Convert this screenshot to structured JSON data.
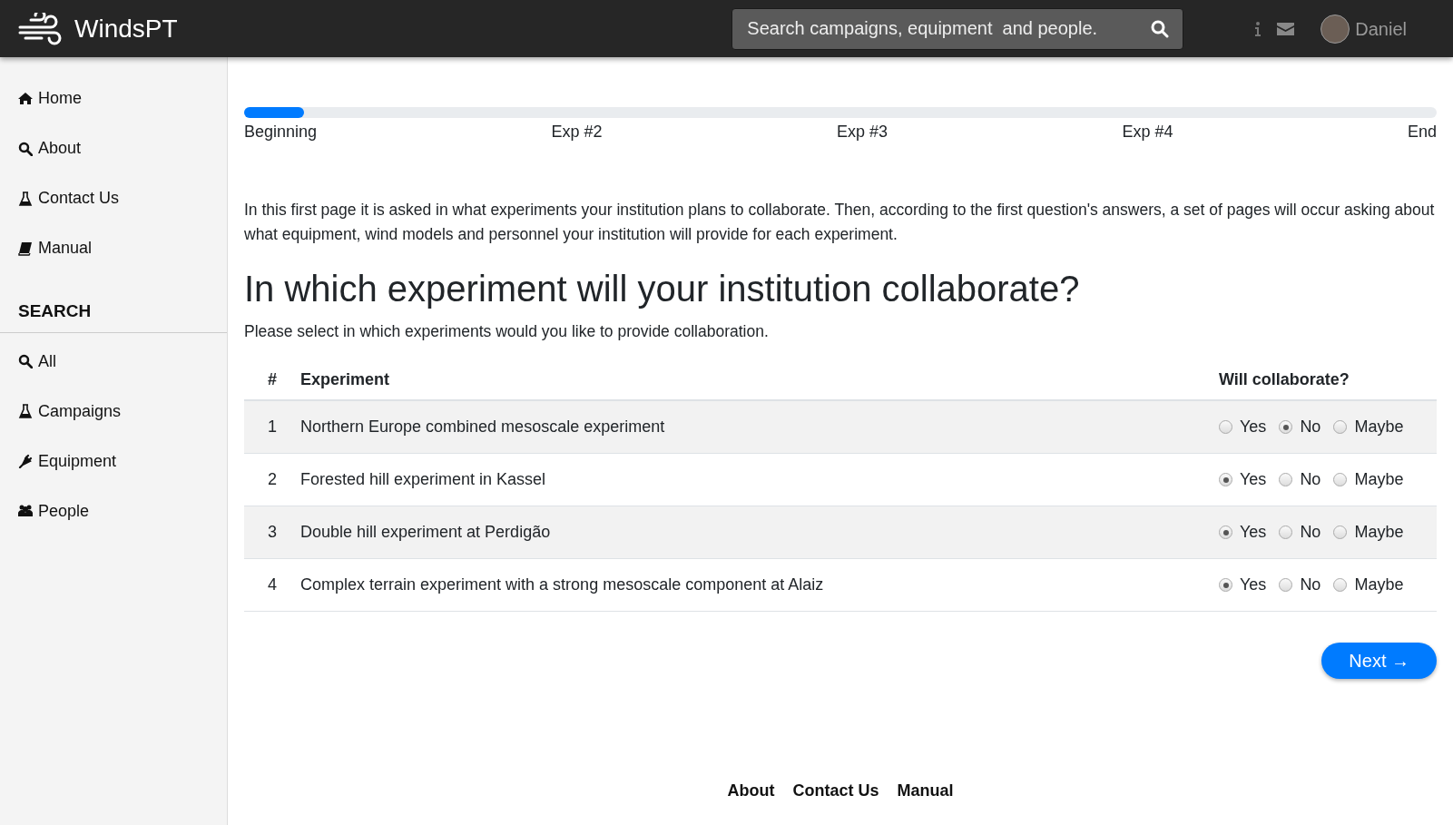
{
  "header": {
    "brand": "WindsPT",
    "search": {
      "placeholder": "Search campaigns, equipment  and people."
    },
    "user": "Daniel"
  },
  "sidebar": {
    "items": [
      {
        "label": "Home"
      },
      {
        "label": "About"
      },
      {
        "label": "Contact Us"
      },
      {
        "label": "Manual"
      }
    ],
    "search_heading": "SEARCH",
    "search_items": [
      {
        "label": "All"
      },
      {
        "label": "Campaigns"
      },
      {
        "label": "Equipment"
      },
      {
        "label": "People"
      }
    ]
  },
  "progress": {
    "level": 0.05,
    "steps": [
      "Beginning",
      "Exp #2",
      "Exp #3",
      "Exp #4",
      "End"
    ]
  },
  "intro": "In this first page it is asked in what experiments your institution plans to collaborate. Then, according to the first question's answers, a set of pages will occur asking about what equipment, wind models and personnel your institution will provide for each experiment.",
  "heading": "In which experiment will your institution collaborate?",
  "subheading": "Please select in which experiments would you like to provide collaboration.",
  "table": {
    "columns": [
      "#",
      "Experiment",
      "Will collaborate?"
    ],
    "rows": [
      {
        "number": "1",
        "experiment": "Northern Europe combined mesoscale experiment",
        "options": [
          {
            "label": "Yes",
            "selected": false
          },
          {
            "label": "No",
            "selected": true
          },
          {
            "label": "Maybe",
            "selected": false
          }
        ]
      },
      {
        "number": "2",
        "experiment": "Forested hill experiment in Kassel",
        "options": [
          {
            "label": "Yes",
            "selected": true
          },
          {
            "label": "No",
            "selected": false
          },
          {
            "label": "Maybe",
            "selected": false
          }
        ]
      },
      {
        "number": "3",
        "experiment": "Double hill experiment at Perdigão",
        "options": [
          {
            "label": "Yes",
            "selected": true
          },
          {
            "label": "No",
            "selected": false
          },
          {
            "label": "Maybe",
            "selected": false
          }
        ]
      },
      {
        "number": "4",
        "experiment": "Complex terrain experiment with a strong mesoscale component at Alaiz",
        "options": [
          {
            "label": "Yes",
            "selected": true
          },
          {
            "label": "No",
            "selected": false
          },
          {
            "label": "Maybe",
            "selected": false
          }
        ]
      }
    ]
  },
  "next_button": "Next →",
  "footer": {
    "links": [
      "About",
      "Contact Us",
      "Manual"
    ]
  }
}
